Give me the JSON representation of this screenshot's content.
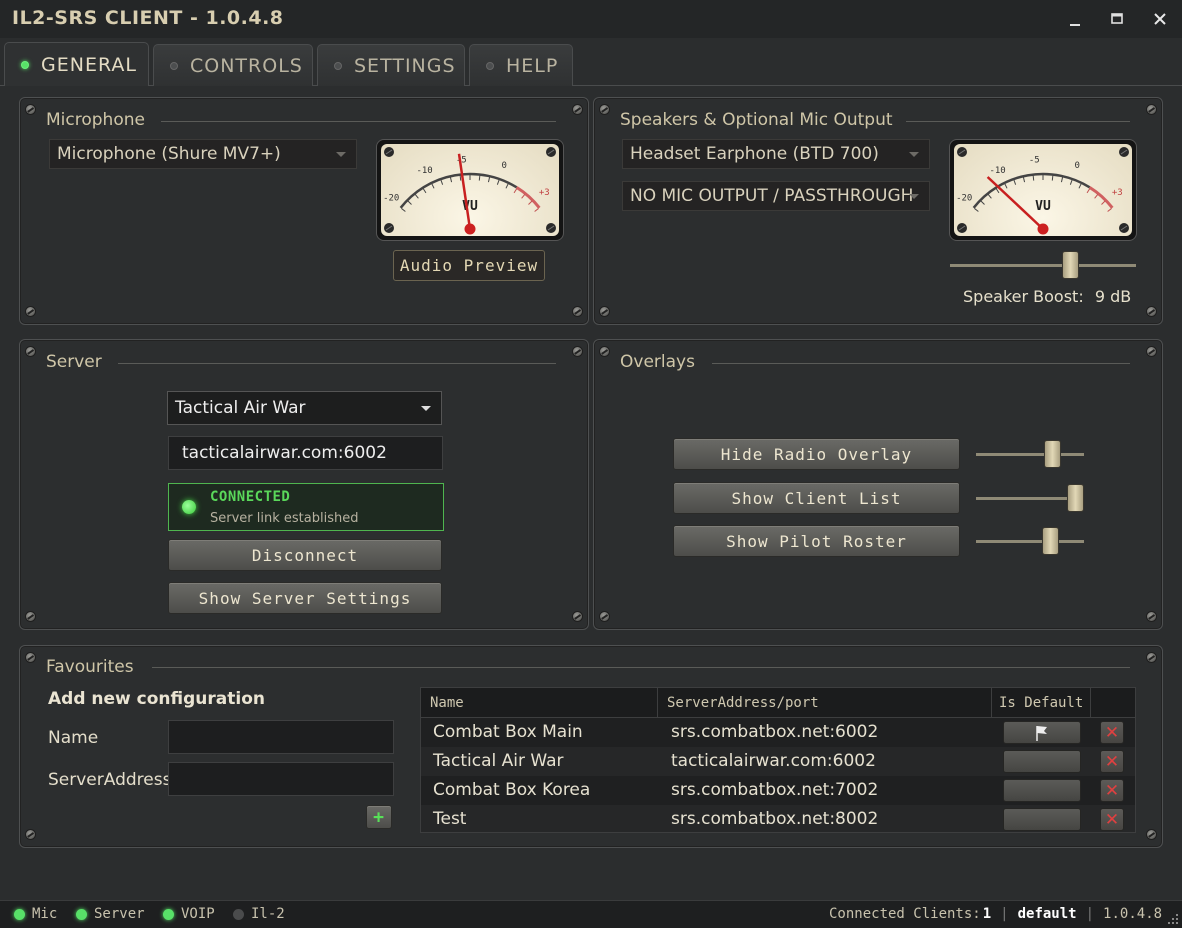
{
  "window": {
    "title": "IL2-SRS CLIENT - 1.0.4.8"
  },
  "tabs": [
    {
      "label": "GENERAL",
      "active": true
    },
    {
      "label": "CONTROLS",
      "active": false
    },
    {
      "label": "SETTINGS",
      "active": false
    },
    {
      "label": "HELP",
      "active": false
    }
  ],
  "microphone": {
    "title": "Microphone",
    "device": "Microphone (Shure MV7+)",
    "vu_label": "VU",
    "preview_button": "Audio Preview",
    "vu_level": 0.42
  },
  "speakers": {
    "title": "Speakers & Optional Mic Output",
    "device": "Headset Earphone (BTD 700)",
    "mic_output": "NO MIC OUTPUT / PASSTHROUGH",
    "vu_label": "VU",
    "boost_label": "Speaker Boost:",
    "boost_value": "9 dB",
    "vu_level": 0.05,
    "boost_fraction": 0.66
  },
  "vu_scale": {
    "m20": "-20",
    "m10": "-10",
    "m5": "-5",
    "zero": "0",
    "p3": "+3"
  },
  "server": {
    "title": "Server",
    "selected": "Tactical Air War",
    "address": "tacticalairwar.com:6002",
    "status_title": "CONNECTED",
    "status_sub": "Server link established",
    "disconnect_button": "Disconnect",
    "settings_button": "Show Server Settings"
  },
  "overlays": {
    "title": "Overlays",
    "items": [
      {
        "label": "Hide Radio Overlay",
        "opacity": 0.75
      },
      {
        "label": "Show Client List",
        "opacity": 1.0
      },
      {
        "label": "Show Pilot Roster",
        "opacity": 0.72
      }
    ]
  },
  "favourites": {
    "title": "Favourites",
    "add_heading": "Add new configuration",
    "name_label": "Name",
    "address_label": "ServerAddress",
    "add_icon": "+",
    "columns": {
      "name": "Name",
      "address": "ServerAddress/port",
      "default": "Is Default"
    },
    "rows": [
      {
        "name": "Combat Box Main",
        "address": "srs.combatbox.net:6002",
        "is_default": true
      },
      {
        "name": "Tactical Air War",
        "address": "tacticalairwar.com:6002",
        "is_default": false
      },
      {
        "name": "Combat Box Korea",
        "address": "srs.combatbox.net:7002",
        "is_default": false
      },
      {
        "name": "Test",
        "address": "srs.combatbox.net:8002",
        "is_default": false
      }
    ],
    "delete_icon": "✕"
  },
  "statusbar": {
    "indicators": [
      {
        "label": "Mic",
        "on": true
      },
      {
        "label": "Server",
        "on": true
      },
      {
        "label": "VOIP",
        "on": true
      },
      {
        "label": "Il-2",
        "on": false
      }
    ],
    "clients_label": "Connected Clients:",
    "clients_count": "1",
    "profile": "default",
    "version": "1.0.4.8",
    "sep": "|"
  },
  "colors": {
    "led_on": "#58e068",
    "led_off": "#4a4b4c",
    "accent": "#d8ceb0"
  }
}
